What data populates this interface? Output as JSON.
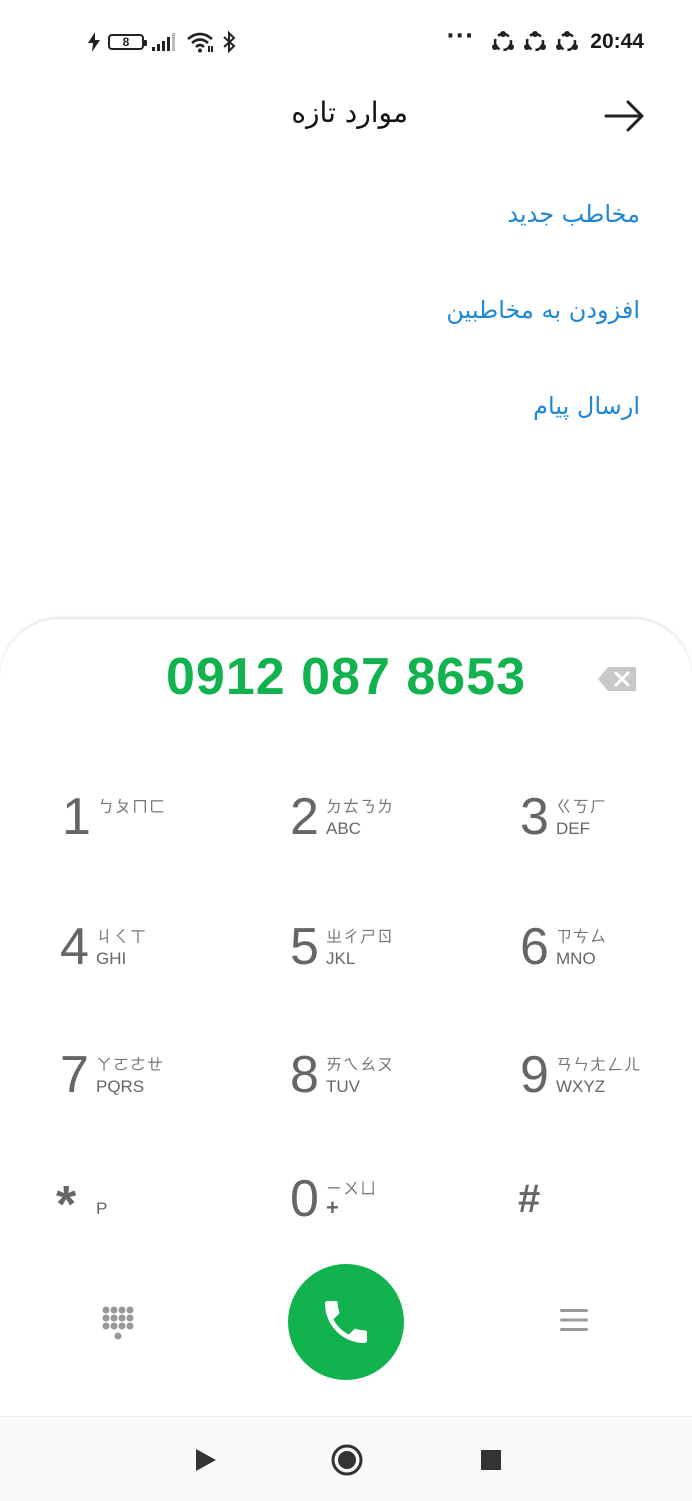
{
  "status_bar": {
    "time": "20:44",
    "battery_level": "8",
    "overflow_dots": "···",
    "icons": [
      "charging-bolt-icon",
      "battery-icon",
      "signal-icon",
      "wifi-icon",
      "bluetooth-icon",
      "notification-icon",
      "notification-icon",
      "notification-icon"
    ]
  },
  "header": {
    "title": "موارد تازه",
    "back_icon": "arrow-icon"
  },
  "actions": [
    {
      "label": "مخاطب جدید"
    },
    {
      "label": "افزودن به مخاطبین"
    },
    {
      "label": "ارسال پیام"
    }
  ],
  "dialer": {
    "number": "0912 087 8653",
    "backspace_icon": "backspace-icon",
    "keys": [
      {
        "digit": "1",
        "zhuyin": "ㄅㄆㄇㄈ",
        "letters": ""
      },
      {
        "digit": "2",
        "zhuyin": "ㄉㄊㄋㄌ",
        "letters": "ABC"
      },
      {
        "digit": "3",
        "zhuyin": "ㄍㄎㄏ",
        "letters": "DEF"
      },
      {
        "digit": "4",
        "zhuyin": "ㄐㄑㄒ",
        "letters": "GHI"
      },
      {
        "digit": "5",
        "zhuyin": "ㄓㄔㄕㄖ",
        "letters": "JKL"
      },
      {
        "digit": "6",
        "zhuyin": "ㄗㄘㄙ",
        "letters": "MNO"
      },
      {
        "digit": "7",
        "zhuyin": "ㄚㄛㄜㄝ",
        "letters": "PQRS"
      },
      {
        "digit": "8",
        "zhuyin": "ㄞㄟㄠㄡ",
        "letters": "TUV"
      },
      {
        "digit": "9",
        "zhuyin": "ㄢㄣㄤㄥㄦ",
        "letters": "WXYZ"
      },
      {
        "digit": "*",
        "zhuyin": "",
        "letters": "P"
      },
      {
        "digit": "0",
        "zhuyin": "ㄧㄨㄩ",
        "letters": "+"
      },
      {
        "digit": "#",
        "zhuyin": "",
        "letters": ""
      }
    ],
    "call_color": "#12b34f",
    "number_color": "#12b34f"
  },
  "nav": {
    "icons": [
      "back-triangle-icon",
      "home-circle-icon",
      "recents-square-icon"
    ]
  },
  "colors": {
    "accent_link": "#1e88d6",
    "call_green": "#12b34f"
  }
}
